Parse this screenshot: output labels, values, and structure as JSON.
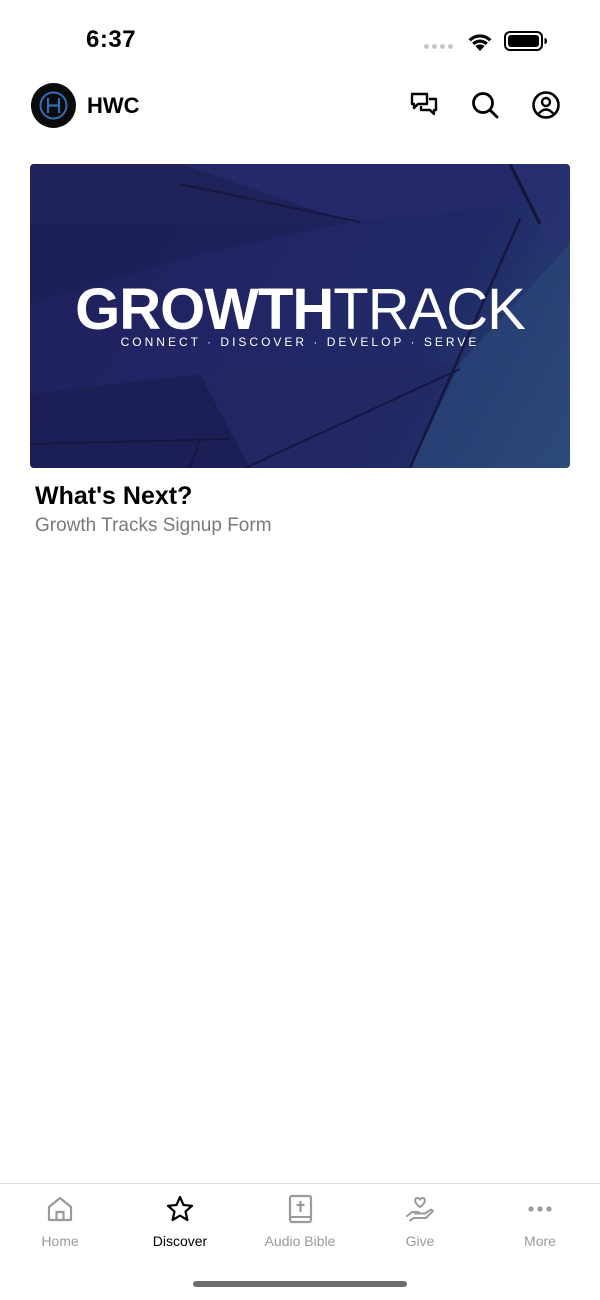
{
  "status_bar": {
    "time": "6:37",
    "icons": [
      "signal-icon",
      "wifi-icon",
      "battery-icon"
    ]
  },
  "header": {
    "logo_icon": "hwc-logo-icon",
    "title": "HWC",
    "actions": [
      {
        "icon": "chat-icon"
      },
      {
        "icon": "search-icon"
      },
      {
        "icon": "account-icon"
      }
    ]
  },
  "card": {
    "banner": {
      "title_bold": "GROWTH",
      "title_light": "TRACK",
      "tagline": "CONNECT · DISCOVER · DEVELOP · SERVE",
      "colors": {
        "dark": "#1e2058",
        "light": "#2f4a78"
      }
    },
    "title": "What's Next?",
    "subtitle": "Growth Tracks Signup Form"
  },
  "tab_bar": {
    "active": "Discover",
    "tabs": [
      {
        "label": "Home",
        "icon": "home-icon"
      },
      {
        "label": "Discover",
        "icon": "star-icon"
      },
      {
        "label": "Audio Bible",
        "icon": "bible-icon"
      },
      {
        "label": "Give",
        "icon": "give-icon"
      },
      {
        "label": "More",
        "icon": "more-icon"
      }
    ]
  },
  "colors": {
    "accent": "#000000",
    "inactive": "#9a9a9a",
    "subtitle": "#7a7a7a",
    "logo_blue": "#2f6fb5"
  }
}
